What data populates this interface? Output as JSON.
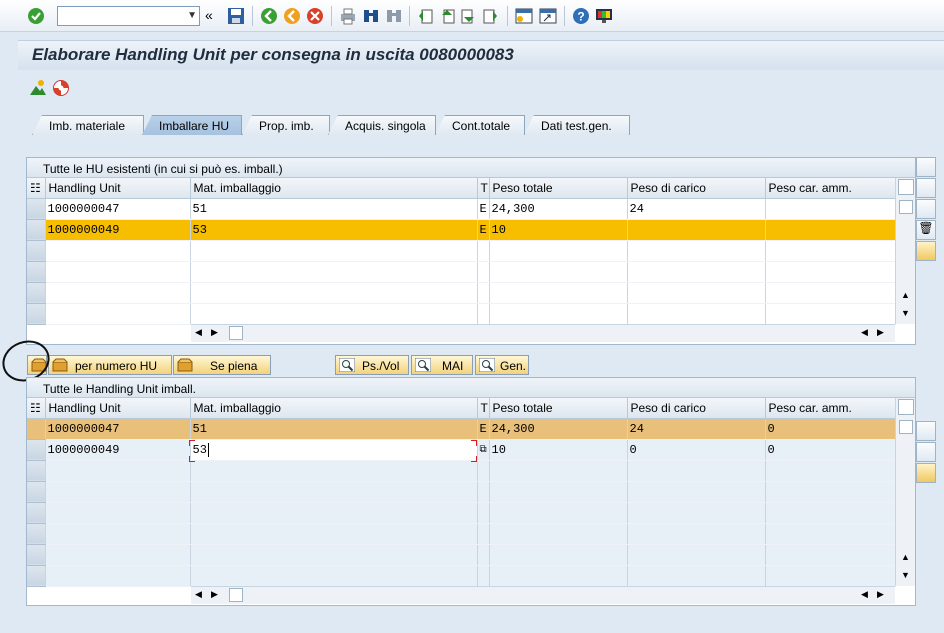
{
  "toolbar": {
    "command_value": "",
    "icons": [
      "check-icon",
      "back-arrows-icon",
      "save-icon",
      "back-icon",
      "exit-icon",
      "cancel-icon",
      "print-icon",
      "find-icon",
      "find-next-icon",
      "first-page-icon",
      "prev-page-icon",
      "next-page-icon",
      "last-page-icon",
      "new-session-icon",
      "shortcut-icon",
      "help-icon",
      "layout-icon"
    ]
  },
  "title": "Elaborare Handling Unit per consegna in uscita 0080000083",
  "tabs": [
    {
      "label": "Imb. materiale"
    },
    {
      "label": "Imballare HU"
    },
    {
      "label": "Prop. imb."
    },
    {
      "label": "Acquis. singola"
    },
    {
      "label": "Cont.totale"
    },
    {
      "label": "Dati test.gen."
    }
  ],
  "upper_table": {
    "title": "Tutte le HU esistenti (in cui si può es. imball.)",
    "columns": [
      "Handling Unit",
      "Mat. imballaggio",
      "T",
      "Peso totale",
      "Peso di carico",
      "Peso car. amm."
    ],
    "rows": [
      {
        "hu": "1000000047",
        "mat": "51",
        "t": "E",
        "peso_tot": "24,300",
        "peso_carico": "24",
        "peso_amm": ""
      },
      {
        "hu": "1000000049",
        "mat": "53",
        "t": "E",
        "peso_tot": "10",
        "peso_carico": "",
        "peso_amm": ""
      }
    ]
  },
  "buttons": {
    "per_numero": "per numero HU",
    "se_piena": "Se piena",
    "ps_vol": "Ps./Vol",
    "mai": "MAI",
    "gen": "Gen."
  },
  "lower_table": {
    "title": "Tutte le Handling Unit imball.",
    "columns": [
      "Handling Unit",
      "Mat. imballaggio",
      "T",
      "Peso totale",
      "Peso di carico",
      "Peso car. amm."
    ],
    "rows": [
      {
        "hu": "1000000047",
        "mat": "51",
        "t": "E",
        "peso_tot": "24,300",
        "peso_carico": "24",
        "peso_amm": "0"
      },
      {
        "hu": "1000000049",
        "mat": "53",
        "t": "",
        "peso_tot": "10",
        "peso_carico": "0",
        "peso_amm": "0"
      }
    ]
  },
  "colors": {
    "highlight": "#f7be00",
    "highlight_soft": "#e8c07a",
    "background": "#dfe9f3"
  }
}
